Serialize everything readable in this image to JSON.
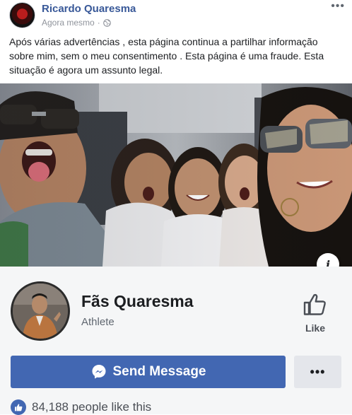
{
  "post": {
    "author": "Ricardo Quaresma",
    "timestamp": "Agora mesmo",
    "separator": "·",
    "privacy_icon": "globe-icon",
    "more_icon": "•••",
    "text": "Após várias advertências , esta página continua a partilhar informação sobre mim, sem o meu consentimento . Esta página é uma fraude. Esta situação é agora um assunto legal."
  },
  "photo": {
    "info_label": "i"
  },
  "page_card": {
    "name": "Fãs Quaresma",
    "category": "Athlete",
    "like_label": "Like",
    "send_message_label": "Send Message",
    "more_label": "•••",
    "likes_text": "84,188 people like this"
  },
  "colors": {
    "link": "#385898",
    "button_blue": "#4267b2",
    "card_bg": "#f5f6f7"
  }
}
